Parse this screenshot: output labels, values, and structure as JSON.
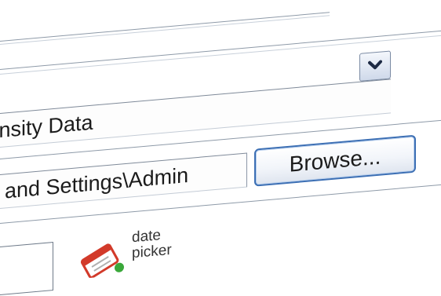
{
  "dataset_select": {
    "value": "tensity Data"
  },
  "file_path": {
    "value": "and Settings\\Admin"
  },
  "browse_button": {
    "label": "Browse..."
  },
  "date_picker": {
    "icon": "date-picker-icon",
    "label_line1": "date",
    "label_line2": "picker"
  },
  "colors": {
    "button_border": "#3c6fb4",
    "field_border": "#7f8a99",
    "icon_red": "#d23a2a",
    "icon_green": "#3aa83a"
  }
}
